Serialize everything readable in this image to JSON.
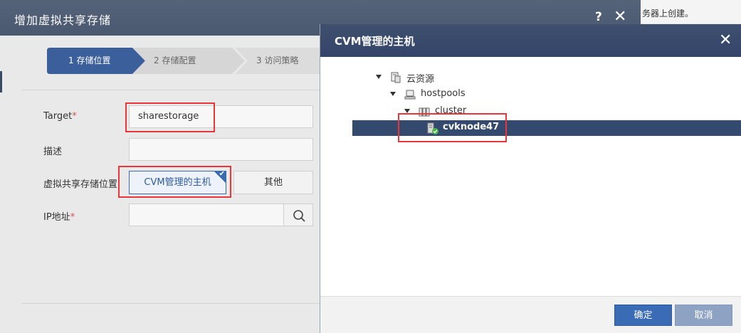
{
  "background_page": {
    "fragment_text": "务器上创建。"
  },
  "bg_dialog": {
    "title": "增加虚拟共享存储",
    "help_label": "?",
    "close_label": "✕",
    "steps": [
      {
        "label": "1 存储位置",
        "active": true
      },
      {
        "label": "2 存储配置",
        "active": false
      },
      {
        "label": "3 访问策略",
        "active": false
      }
    ],
    "form": {
      "target_label": "Target",
      "target_value": "sharestorage",
      "description_label": "描述",
      "location_label": "虚拟共享存储位置",
      "location_option_cvm": "CVM管理的主机",
      "location_option_other": "其他",
      "ip_label": "IP地址",
      "required_mark": "*"
    }
  },
  "modal": {
    "title": "CVM管理的主机",
    "close_label": "✕",
    "tree": [
      {
        "label": "云资源",
        "icon": "cloud-resource-icon",
        "level": 0
      },
      {
        "label": "hostpools",
        "icon": "hostpool-icon",
        "level": 1
      },
      {
        "label": "cluster",
        "icon": "cluster-icon",
        "level": 2
      },
      {
        "label": "cvknode47",
        "icon": "host-online-icon",
        "level": 3,
        "selected": true
      }
    ],
    "ok_label": "确定",
    "cancel_label": "取消"
  },
  "colors": {
    "header_dark": "#34456a",
    "selected_row": "#34496e",
    "primary_button": "#3a6bb5",
    "highlight_red": "#e8363a"
  }
}
